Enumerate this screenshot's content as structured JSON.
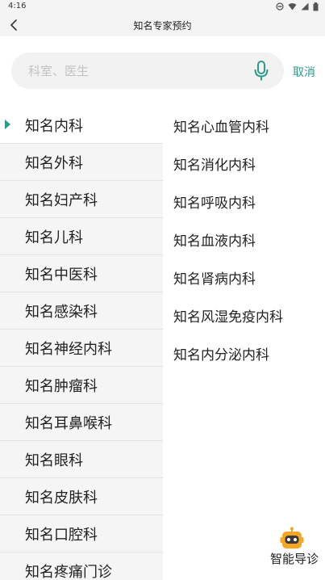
{
  "status_bar": {
    "time": "4:16"
  },
  "nav": {
    "title": "知名专家预约"
  },
  "search": {
    "placeholder": "科室、医生",
    "cancel_label": "取消"
  },
  "colors": {
    "accent": "#2e9b8a",
    "robot": "#f5a623"
  },
  "departments": [
    {
      "label": "知名内科",
      "active": true
    },
    {
      "label": "知名外科"
    },
    {
      "label": "知名妇产科"
    },
    {
      "label": "知名儿科"
    },
    {
      "label": "知名中医科"
    },
    {
      "label": "知名感染科"
    },
    {
      "label": "知名神经内科"
    },
    {
      "label": "知名肿瘤科"
    },
    {
      "label": "知名耳鼻喉科"
    },
    {
      "label": "知名眼科"
    },
    {
      "label": "知名皮肤科"
    },
    {
      "label": "知名口腔科"
    },
    {
      "label": "知名疼痛门诊"
    }
  ],
  "sub_departments": [
    {
      "label": "知名心血管内科"
    },
    {
      "label": "知名消化内科"
    },
    {
      "label": "知名呼吸内科"
    },
    {
      "label": "知名血液内科"
    },
    {
      "label": "知名肾病内科"
    },
    {
      "label": "知名风湿免疫内科"
    },
    {
      "label": "知名内分泌内科"
    }
  ],
  "guide": {
    "label": "智能导诊",
    "icon": "robot-icon"
  }
}
